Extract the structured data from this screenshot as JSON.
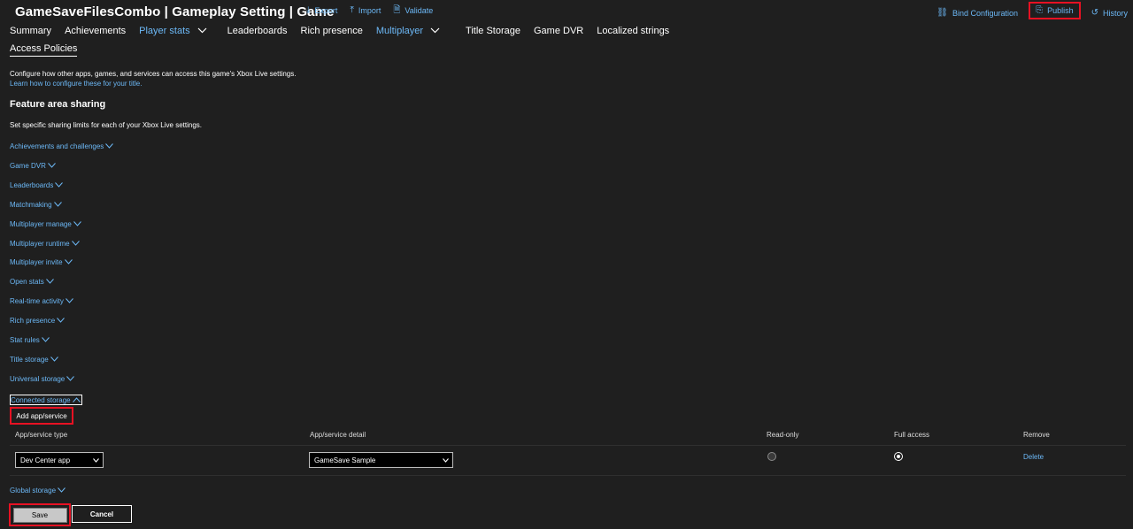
{
  "header": {
    "title": "GameSaveFilesCombo | Gameplay Setting | Game",
    "toolbar_left": [
      {
        "label": "Export",
        "icon": "download-icon"
      },
      {
        "label": "Import",
        "icon": "upload-icon"
      },
      {
        "label": "Validate",
        "icon": "validate-icon"
      }
    ],
    "toolbar_right": [
      {
        "label": "Bind Configuration",
        "icon": "link-icon"
      },
      {
        "label": "Publish",
        "icon": "publish-icon"
      },
      {
        "label": "History",
        "icon": "history-icon"
      }
    ]
  },
  "nav": {
    "tabs": [
      {
        "label": "Summary"
      },
      {
        "label": "Achievements"
      },
      {
        "label": "Player stats",
        "dropdown": true,
        "active": true
      },
      {
        "label": "Leaderboards"
      },
      {
        "label": "Rich presence"
      },
      {
        "label": "Multiplayer",
        "dropdown": true,
        "active": true
      },
      {
        "label": "Title Storage"
      },
      {
        "label": "Game DVR"
      },
      {
        "label": "Localized strings"
      }
    ],
    "subtab": "Access Policies"
  },
  "intro": {
    "text": "Configure how other apps, games, and services can access this game's Xbox Live settings.",
    "link": "Learn how to configure these for your title."
  },
  "feature": {
    "heading": "Feature area sharing",
    "description": "Set specific sharing limits for each of your Xbox Live settings.",
    "areas": [
      "Achievements and challenges",
      "Game DVR",
      "Leaderboards",
      "Matchmaking",
      "Multiplayer manage",
      "Multiplayer runtime",
      "Multiplayer invite",
      "Open stats",
      "Real-time activity",
      "Rich presence",
      "Stat rules",
      "Title storage",
      "Universal storage",
      "Connected storage"
    ],
    "global_storage": "Global storage"
  },
  "connected": {
    "add_button": "Add app/service",
    "columns": [
      "App/service type",
      "App/service detail",
      "Read-only",
      "Full access",
      "Remove"
    ],
    "row": {
      "type": "Dev Center app",
      "detail": "GameSave Sample",
      "read_only": false,
      "full_access": true,
      "remove": "Delete"
    }
  },
  "actions": {
    "save": "Save",
    "cancel": "Cancel"
  },
  "colors": {
    "background": "#1f1f1f",
    "link": "#6cb8f6",
    "highlight": "#e81123"
  }
}
